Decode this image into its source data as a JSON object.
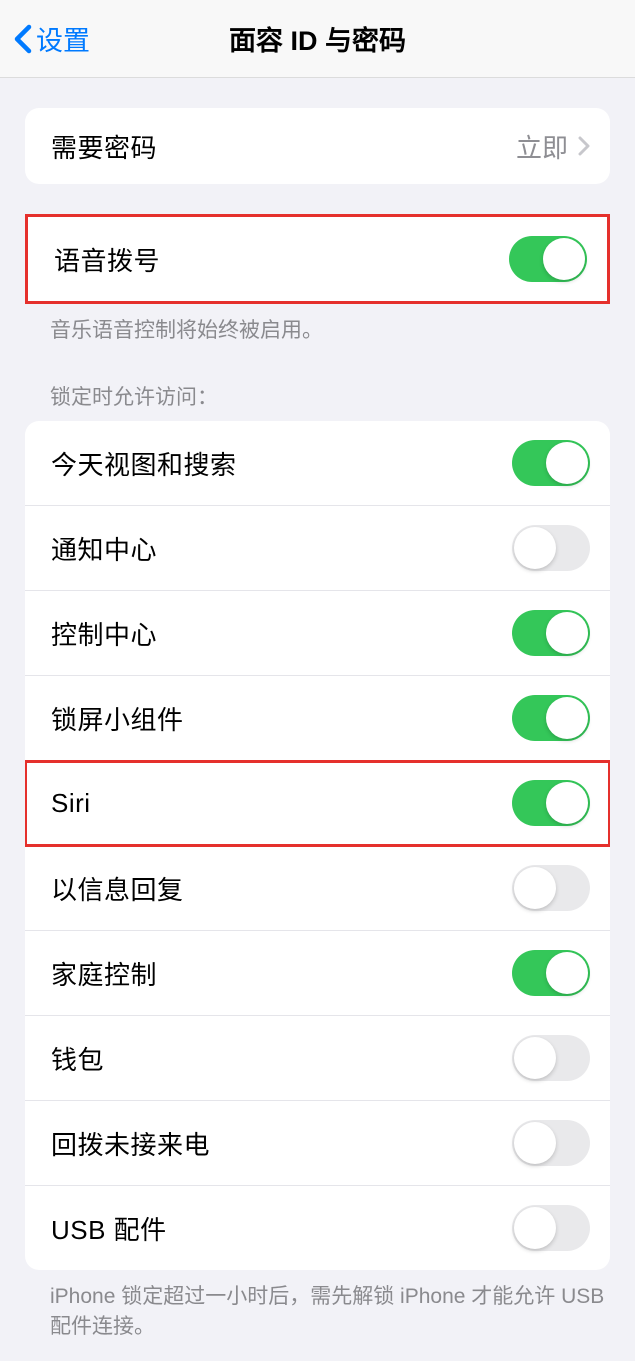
{
  "header": {
    "back_label": "设置",
    "title": "面容 ID 与密码"
  },
  "require_passcode": {
    "label": "需要密码",
    "value": "立即"
  },
  "voice_dial": {
    "label": "语音拨号",
    "on": true,
    "footer": "音乐语音控制将始终被启用。"
  },
  "locked_section_header": "锁定时允许访问：",
  "locked_items": [
    {
      "label": "今天视图和搜索",
      "on": true
    },
    {
      "label": "通知中心",
      "on": false
    },
    {
      "label": "控制中心",
      "on": true
    },
    {
      "label": "锁屏小组件",
      "on": true
    },
    {
      "label": "Siri",
      "on": true,
      "highlight": true
    },
    {
      "label": "以信息回复",
      "on": false
    },
    {
      "label": "家庭控制",
      "on": true
    },
    {
      "label": "钱包",
      "on": false
    },
    {
      "label": "回拨未接来电",
      "on": false
    },
    {
      "label": "USB 配件",
      "on": false
    }
  ],
  "usb_footer": "iPhone 锁定超过一小时后，需先解锁 iPhone 才能允许 USB 配件连接。"
}
